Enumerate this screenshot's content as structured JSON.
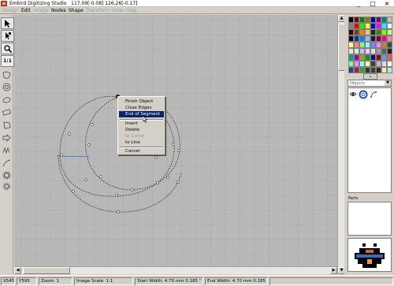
{
  "window": {
    "title": "Embird Digitizing Studio",
    "coords": "117.09[-0.08] 126.26[-0.17]",
    "buttons": [
      "_",
      "□",
      "×"
    ]
  },
  "menu": [
    {
      "label": "Design",
      "enabled": false
    },
    {
      "label": "Edit",
      "enabled": true
    },
    {
      "label": "Image",
      "enabled": false
    },
    {
      "label": "Nodes",
      "enabled": true
    },
    {
      "label": "Shape",
      "enabled": true
    },
    {
      "label": "Transform",
      "enabled": false
    },
    {
      "label": "View",
      "enabled": false
    },
    {
      "label": "Help",
      "enabled": false
    }
  ],
  "toolbox": {
    "scale_label": "1:1",
    "tools": [
      "select-arrow",
      "node-edit",
      "zoom",
      "scale-1-1",
      "shape-outline",
      "circle",
      "ellipse",
      "rotate",
      "polygon",
      "star",
      "zigzag",
      "line",
      "gear",
      "gear-small"
    ]
  },
  "context_menu": {
    "items": [
      {
        "label": "Finish Object",
        "state": "normal"
      },
      {
        "label": "Close Edges",
        "state": "normal"
      },
      {
        "label": "End of Segment",
        "state": "highlighted"
      },
      {
        "separator": true
      },
      {
        "label": "Insert",
        "state": "normal"
      },
      {
        "label": "Delete",
        "state": "normal"
      },
      {
        "label": "to Curve",
        "state": "disabled"
      },
      {
        "label": "to Line",
        "state": "normal"
      },
      {
        "separator": true
      },
      {
        "label": "Cancel",
        "state": "normal"
      }
    ]
  },
  "palette": {
    "colors": [
      "#000000",
      "#800000",
      "#008000",
      "#808000",
      "#000080",
      "#800080",
      "#008080",
      "#c0c0c0",
      "#808080",
      "#ff0000",
      "#00ff00",
      "#ffff00",
      "#0000ff",
      "#ff00ff",
      "#00ffff",
      "#ffffff",
      "#400000",
      "#804000",
      "#ff8000",
      "#ffc080",
      "#004000",
      "#408000",
      "#80ff00",
      "#c0ff80",
      "#000040",
      "#004080",
      "#0080ff",
      "#80c0ff",
      "#400040",
      "#800040",
      "#ff0080",
      "#ff80c0",
      "#ffff80",
      "#ff8080",
      "#80ff80",
      "#80ffff",
      "#8080ff",
      "#ff80ff",
      "#c08040",
      "#404040",
      "#ffe0c0",
      "#c0ffc0",
      "#c0c0ff",
      "#ffc0ff",
      "#e0e0e0",
      "#a0a0a0",
      "#606060",
      "#202020",
      "#00a0a0",
      "#a000a0",
      "#a0a000",
      "#00a000",
      "#0000a0",
      "#a00000",
      "#50a0ff",
      "#ff5050",
      "#7fff7f",
      "#ff7fff",
      "#7fffff",
      "#ffff7f",
      "#3f3f3f",
      "#bfbfbf",
      "#dfdfdf",
      "#ffffff",
      "#2040a0",
      "#a02040",
      "#40a020",
      "#204040",
      "#404020",
      "#402040",
      "#f0f0a0",
      "#a0f0f0"
    ],
    "dropdown_arrow": "⌄"
  },
  "object_panel": {
    "selector_value": "Objects",
    "objects": [
      {
        "visible_icon": "eye-icon",
        "kind": "spiral-object"
      }
    ]
  },
  "parts_panel": {
    "label": "Parts"
  },
  "status": {
    "coords_x": "X545",
    "coords_y": "Y595",
    "zoom": "Zoom: 1",
    "image_scale": "Image Scale: 1:1",
    "start_width": "Start Width: 4.70  mm    0.185 ''",
    "end_width": "End Width: 4.70  mm    0.185 ''"
  },
  "colors": {
    "selection_blue": "#0a246a",
    "curve": "#404040",
    "guide_line": "#2e6fd0"
  }
}
